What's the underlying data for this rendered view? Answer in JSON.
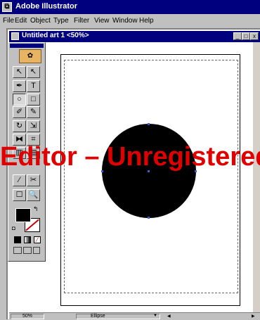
{
  "app": {
    "title": "Adobe Illustrator"
  },
  "menu": {
    "items": [
      "File",
      "Edit",
      "Object",
      "Type",
      "Filter",
      "View",
      "Window",
      "Help"
    ]
  },
  "document": {
    "title": "Untitled art 1 <50%>"
  },
  "window_buttons": {
    "minimize": "_",
    "restore": "▫",
    "close": "x"
  },
  "doc_buttons": {
    "minimize": "_",
    "restore": "□",
    "close": "x"
  },
  "toolbox": {
    "tools": [
      {
        "name": "selection",
        "glyph": "↖"
      },
      {
        "name": "direct-selection",
        "glyph": "↖"
      },
      {
        "name": "pen",
        "glyph": "✒"
      },
      {
        "name": "type",
        "glyph": "T"
      },
      {
        "name": "ellipse",
        "glyph": "○"
      },
      {
        "name": "rectangle",
        "glyph": "□"
      },
      {
        "name": "paintbrush",
        "glyph": "✐"
      },
      {
        "name": "pencil",
        "glyph": "✎"
      },
      {
        "name": "rotate",
        "glyph": "↻"
      },
      {
        "name": "scale",
        "glyph": "⇲"
      },
      {
        "name": "reflect",
        "glyph": "⧓"
      },
      {
        "name": "blend",
        "glyph": "⌗"
      },
      {
        "name": "graph",
        "glyph": "▥"
      },
      {
        "name": "gradient",
        "glyph": "▤"
      },
      {
        "name": "eyedropper",
        "glyph": "⁄"
      },
      {
        "name": "scissors",
        "glyph": "✂"
      },
      {
        "name": "hand",
        "glyph": "☐"
      },
      {
        "name": "zoom",
        "glyph": "🔍"
      }
    ],
    "fill_color": "#000000",
    "stroke_color": "#ffffff"
  },
  "status_bar": {
    "zoom": "50%",
    "status": "Ellipse"
  },
  "watermark": "Editor – Unregistered",
  "colors": {
    "title_blue": "#00007f",
    "chrome": "#c0c0c0",
    "watermark": "#e00000",
    "handle": "#3b5bd9"
  }
}
